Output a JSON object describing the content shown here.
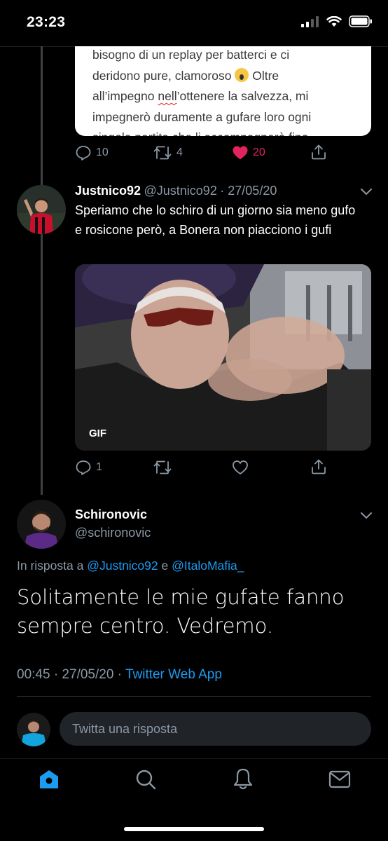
{
  "status_bar": {
    "time": "23:23"
  },
  "quoted_card": {
    "lines": [
      "bisogno di un replay per batterci e ci",
      "deridono pure, clamoroso",
      "Oltre",
      "all’impegno",
      "nell",
      "’ottenere la salvezza, mi",
      "impegnerò duramente a gufare loro ogni",
      "singola partita che li accompagnerà fino"
    ]
  },
  "first_tweet_actions": {
    "replies": "10",
    "retweets": "4",
    "likes": "20"
  },
  "reply_tweet": {
    "name": "Justnico92",
    "handle": "@Justnico92",
    "date": "· 27/05/20",
    "text": "Speriamo che lo schiro di un giorno sia meno gufo e rosicone però, a Bonera non piacciono i gufi",
    "media_label": "GIF",
    "actions": {
      "replies": "1"
    }
  },
  "main_tweet": {
    "name": "Schironovic",
    "handle": "@schironovic",
    "reply_prefix": "In risposta a",
    "mention1": "@Justnico92",
    "conj": "e",
    "mention2": "@ItaloMafia_",
    "text": "Solitamente le mie gufate fanno sempre centro. Vedremo.",
    "time": "00:45 · 27/05/20 ·",
    "app": "Twitter Web App"
  },
  "reply_composer": {
    "placeholder": "Twitta una risposta"
  },
  "colors": {
    "accent": "#1d9bf0",
    "like": "#e0245e",
    "muted": "#8b98a5"
  },
  "tab_bar": {
    "items": [
      "home-icon",
      "search-icon",
      "notifications-icon",
      "messages-icon"
    ]
  }
}
